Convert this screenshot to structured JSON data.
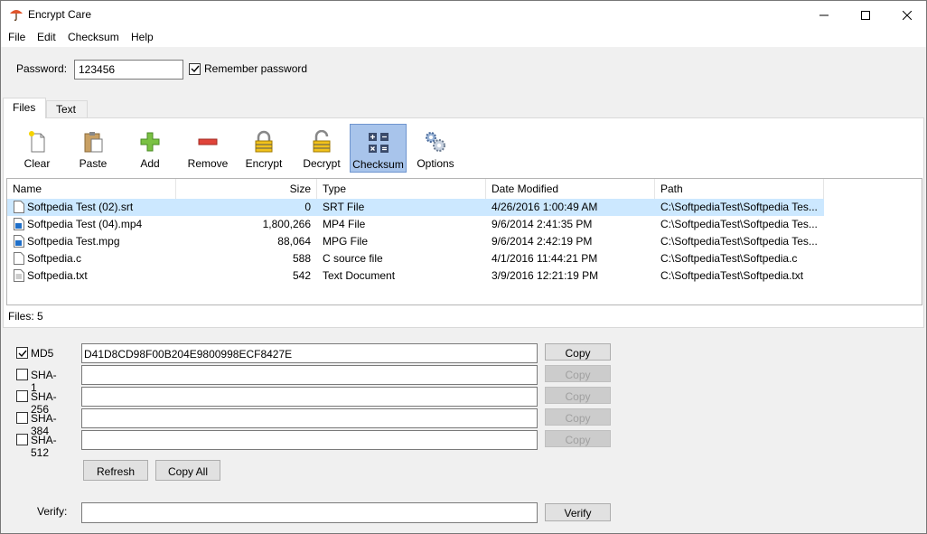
{
  "window": {
    "title": "Encrypt Care"
  },
  "menu": [
    "File",
    "Edit",
    "Checksum",
    "Help"
  ],
  "password": {
    "label": "Password:",
    "value": "123456",
    "remember_label": "Remember password",
    "remember_checked": true
  },
  "tabs": [
    {
      "label": "Files",
      "active": true
    },
    {
      "label": "Text",
      "active": false
    }
  ],
  "toolbar": {
    "clear": "Clear",
    "paste": "Paste",
    "add": "Add",
    "remove": "Remove",
    "encrypt": "Encrypt",
    "decrypt": "Decrypt",
    "checksum": "Checksum",
    "options": "Options"
  },
  "list": {
    "columns": {
      "name": "Name",
      "size": "Size",
      "type": "Type",
      "date": "Date Modified",
      "path": "Path"
    },
    "rows": [
      {
        "name": "Softpedia Test (02).srt",
        "size": "0",
        "type": "SRT File",
        "date": "4/26/2016 1:00:49 AM",
        "path": "C:\\SoftpediaTest\\Softpedia Tes...",
        "icon": "blank-file-icon"
      },
      {
        "name": "Softpedia Test (04).mp4",
        "size": "1,800,266",
        "type": "MP4 File",
        "date": "9/6/2014 2:41:35 PM",
        "path": "C:\\SoftpediaTest\\Softpedia Tes...",
        "icon": "media-file-icon"
      },
      {
        "name": "Softpedia Test.mpg",
        "size": "88,064",
        "type": "MPG File",
        "date": "9/6/2014 2:42:19 PM",
        "path": "C:\\SoftpediaTest\\Softpedia Tes...",
        "icon": "media-file-icon"
      },
      {
        "name": "Softpedia.c",
        "size": "588",
        "type": "C source file",
        "date": "4/1/2016 11:44:21 PM",
        "path": "C:\\SoftpediaTest\\Softpedia.c",
        "icon": "blank-file-icon"
      },
      {
        "name": "Softpedia.txt",
        "size": "542",
        "type": "Text Document",
        "date": "3/9/2016 12:21:19 PM",
        "path": "C:\\SoftpediaTest\\Softpedia.txt",
        "icon": "text-file-icon"
      }
    ]
  },
  "status": {
    "files_count": "Files: 5"
  },
  "checksums": [
    {
      "label": "MD5",
      "checked": true,
      "value": "D41D8CD98F00B204E9800998ECF8427E",
      "copy_label": "Copy",
      "copy_enabled": true
    },
    {
      "label": "SHA-1",
      "checked": false,
      "value": "",
      "copy_label": "Copy",
      "copy_enabled": false
    },
    {
      "label": "SHA-256",
      "checked": false,
      "value": "",
      "copy_label": "Copy",
      "copy_enabled": false
    },
    {
      "label": "SHA-384",
      "checked": false,
      "value": "",
      "copy_label": "Copy",
      "copy_enabled": false
    },
    {
      "label": "SHA-512",
      "checked": false,
      "value": "",
      "copy_label": "Copy",
      "copy_enabled": false
    }
  ],
  "actions": {
    "refresh": "Refresh",
    "copy_all": "Copy All"
  },
  "verify": {
    "label": "Verify:",
    "value": "",
    "button": "Verify"
  },
  "colors": {
    "selection": "#cce8ff",
    "active_tool": "#a8c4eb"
  }
}
